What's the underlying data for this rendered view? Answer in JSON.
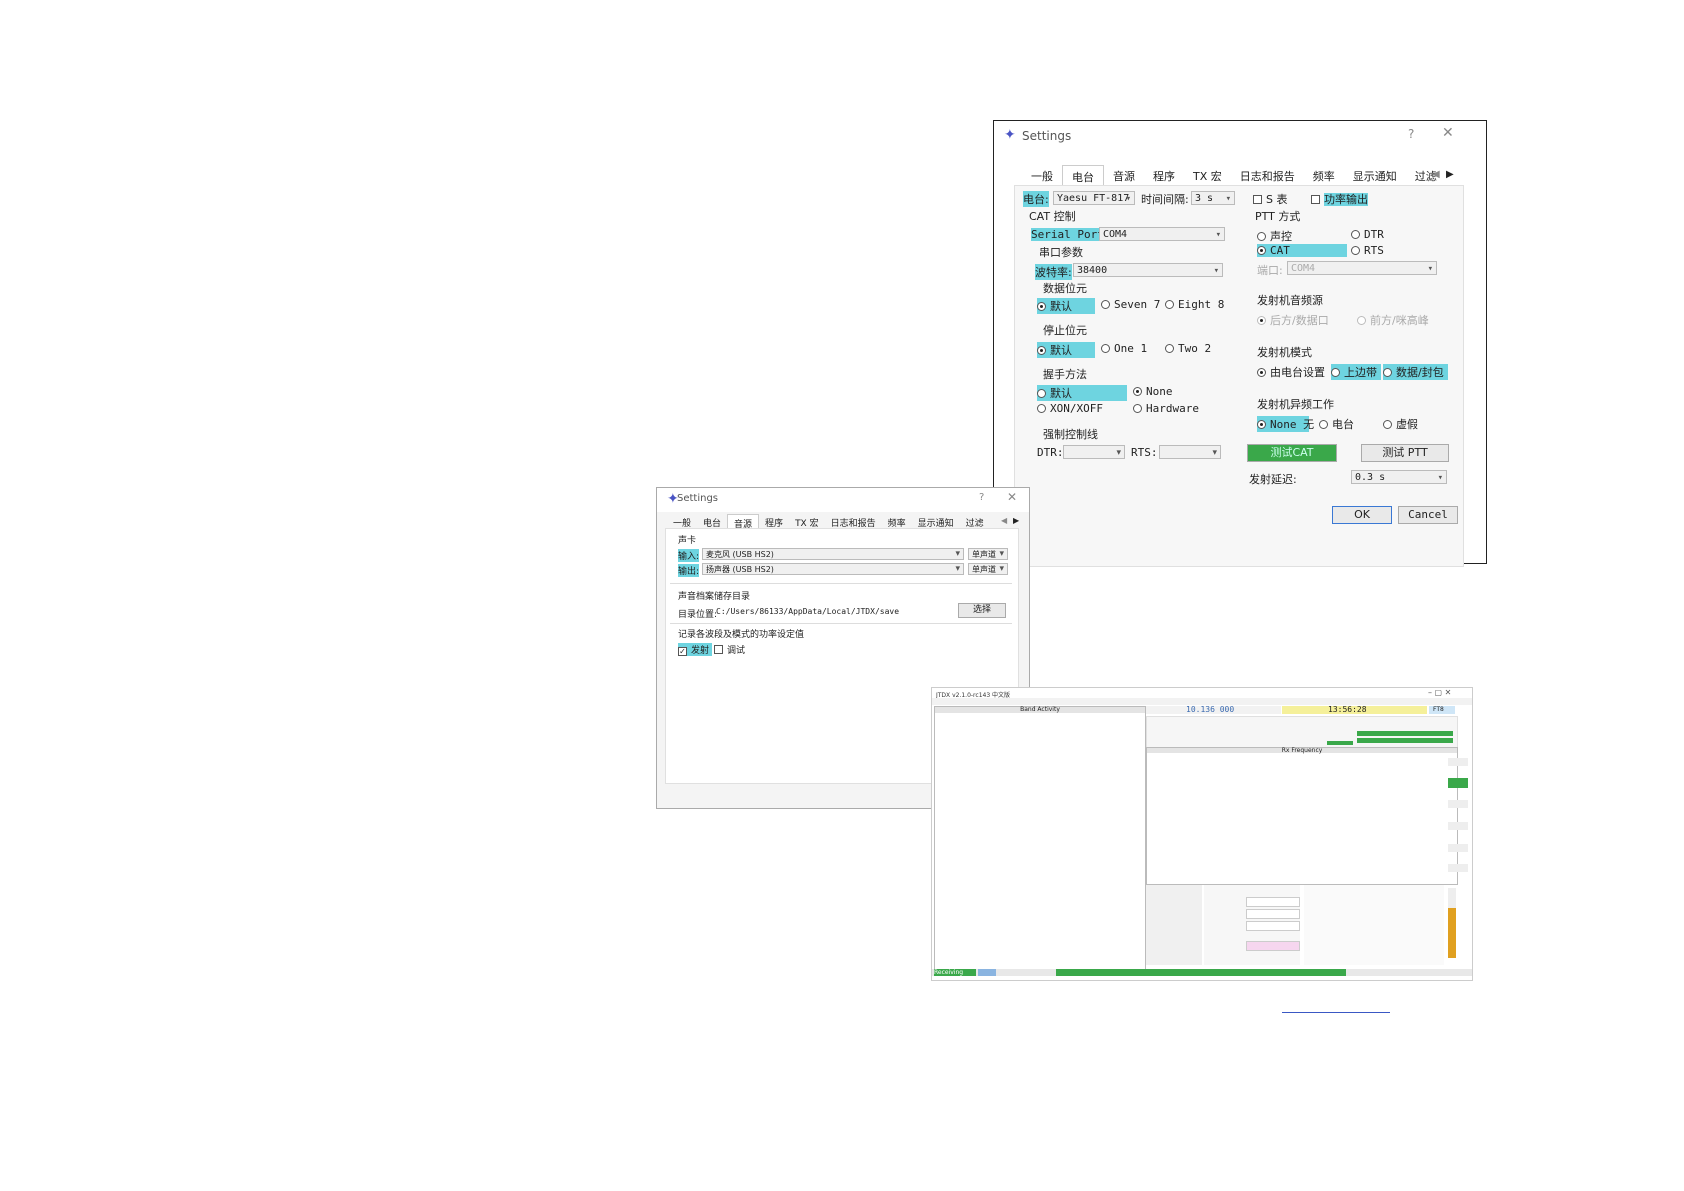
{
  "radio_dialog": {
    "title": "Settings",
    "help": "?",
    "close": "✕",
    "tabs": [
      "一般",
      "电台",
      "音源",
      "程序",
      "TX 宏",
      "日志和报告",
      "频率",
      "显示通知",
      "过滤"
    ],
    "radio_label": "电台:",
    "radio_value": "Yaesu FT-817",
    "interval_label": "时间间隔:",
    "interval_value": "3 s",
    "s_meter": "S 表",
    "power_out": "功率输出",
    "cat_group": "CAT 控制",
    "serial_port_label": "Serial Port:",
    "serial_port_value": "COM4",
    "serial_params": "串口参数",
    "baud_label": "波特率:",
    "baud_value": "38400",
    "data_bits": "数据位元",
    "default": "默认",
    "seven": "Seven 7",
    "eight": "Eight 8",
    "stop_bits": "停止位元",
    "one": "One 1",
    "two": "Two 2",
    "handshake": "握手方法",
    "none": "None",
    "xon": "XON/XOFF",
    "hardware": "Hardware",
    "force_ctrl": "强制控制线",
    "dtr_label": "DTR:",
    "rts_label": "RTS:",
    "ptt_group": "PTT 方式",
    "vox": "声控",
    "dtr": "DTR",
    "cat": "CAT",
    "rts": "RTS",
    "port_label": "端口:",
    "port_value": "COM4",
    "tx_audio": "发射机音频源",
    "rear_data": "后方/数据口",
    "front_mic": "前方/咪高峰",
    "tx_mode": "发射机模式",
    "by_radio": "由电台设置",
    "usb": "上边带",
    "data_pkt": "数据/封包",
    "split": "发射机异频工作",
    "none_cn": "None 无",
    "rig": "电台",
    "fake": "虚假",
    "test_cat": "测试CAT",
    "test_ptt": "测试 PTT",
    "tx_delay_label": "发射延迟:",
    "tx_delay_value": "0.3 s",
    "ok": "OK",
    "cancel": "Cancel"
  },
  "audio_dialog": {
    "title": "Settings",
    "help": "?",
    "close": "✕",
    "tabs": [
      "一般",
      "电台",
      "音源",
      "程序",
      "TX 宏",
      "日志和报告",
      "频率",
      "显示通知",
      "过滤"
    ],
    "soundcard": "声卡",
    "input_label": "输入:",
    "input_value": "麦克风 (USB HS2)",
    "input_channel": "单声道",
    "output_label": "输出:",
    "output_value": "扬声器 (USB HS2)",
    "output_channel": "单声道",
    "save_dir_group": "声音档案储存目录",
    "dir_label": "目录位置:",
    "dir_value": "C:/Users/86133/AppData/Local/JTDX/save",
    "choose": "选择",
    "power_group": "记录各波段及模式的功率设定值",
    "tx": "发射",
    "tune": "调试"
  },
  "jtdx": {
    "title": "JTDX v2.1.0-rc143 中文版",
    "freq": "10.136 000",
    "time": "13:56:28",
    "band_activity": "Band Activity",
    "rx_freq": "Rx Frequency",
    "status_receiving": "Receiving",
    "mode": "FT8"
  },
  "link_text": "________________"
}
